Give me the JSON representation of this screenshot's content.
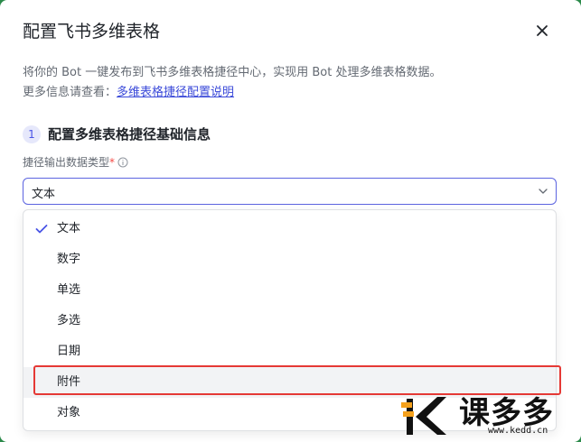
{
  "dialog": {
    "title": "配置飞书多维表格",
    "description_line1": "将你的 Bot 一键发布到飞书多维表格捷径中心，实现用 Bot 处理多维表格数据。",
    "description_prefix": "更多信息请查看：",
    "description_link": "多维表格捷径配置说明"
  },
  "section": {
    "step_number": "1",
    "title": "配置多维表格捷径基础信息"
  },
  "field": {
    "label": "捷径输出数据类型",
    "required_mark": "*",
    "selected_value": "文本"
  },
  "dropdown": {
    "options": [
      {
        "label": "文本",
        "selected": true
      },
      {
        "label": "数字",
        "selected": false
      },
      {
        "label": "单选",
        "selected": false
      },
      {
        "label": "多选",
        "selected": false
      },
      {
        "label": "日期",
        "selected": false
      },
      {
        "label": "附件",
        "selected": false,
        "highlighted": true
      },
      {
        "label": "对象",
        "selected": false
      }
    ]
  },
  "watermark": {
    "brand_text": "课多多",
    "url": "www.kedd.cn"
  },
  "colors": {
    "accent": "#4954e6",
    "link": "#3b4ad9",
    "annotation_red": "#e53935",
    "watermark_orange": "#f5a11c"
  }
}
